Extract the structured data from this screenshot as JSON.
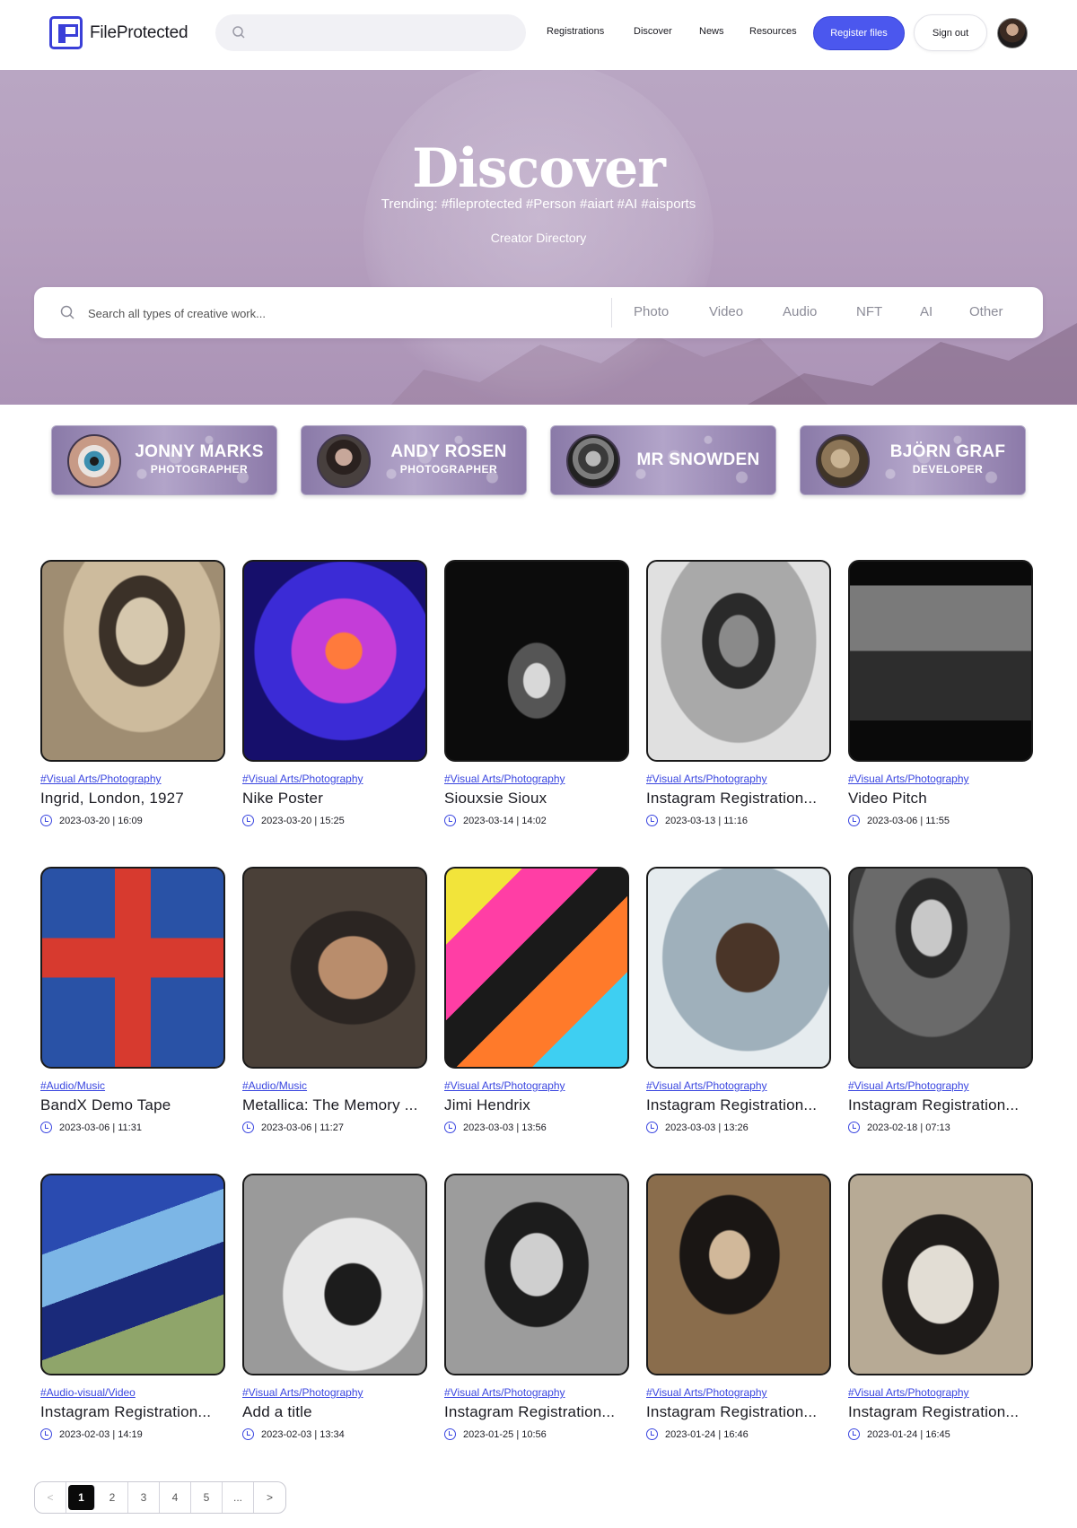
{
  "header": {
    "logo_text": "FileProtected",
    "nav": [
      "Registrations",
      "Discover",
      "News",
      "Resources"
    ],
    "register_label": "Register files",
    "signout_label": "Sign out"
  },
  "hero": {
    "title": "Discover",
    "trending": "Trending: #fileprotected #Person #aiart #AI #aisports",
    "directory_link": "Creator Directory",
    "search_placeholder": "Search all types of creative work...",
    "categories": [
      "Photo",
      "Video",
      "Audio",
      "NFT",
      "AI",
      "Other"
    ]
  },
  "creators": [
    {
      "name": "JONNY MARKS",
      "role": "PHOTOGRAPHER"
    },
    {
      "name": "ANDY ROSEN",
      "role": "PHOTOGRAPHER"
    },
    {
      "name": "MR SNOWDEN",
      "role": ""
    },
    {
      "name": "BJÖRN GRAF",
      "role": "DEVELOPER"
    }
  ],
  "cards": [
    {
      "category": "#Visual Arts/Photography",
      "title": "Ingrid, London, 1927",
      "date": "2023-03-20 | 16:09"
    },
    {
      "category": "#Visual Arts/Photography",
      "title": "Nike Poster",
      "date": "2023-03-20 | 15:25"
    },
    {
      "category": "#Visual Arts/Photography",
      "title": "Siouxsie Sioux",
      "date": "2023-03-14 | 14:02"
    },
    {
      "category": "#Visual Arts/Photography",
      "title": "Instagram Registration...",
      "date": "2023-03-13 | 11:16"
    },
    {
      "category": "#Visual Arts/Photography",
      "title": "Video Pitch",
      "date": "2023-03-06 | 11:55"
    },
    {
      "category": "#Audio/Music",
      "title": "BandX Demo Tape",
      "date": "2023-03-06 | 11:31"
    },
    {
      "category": "#Audio/Music",
      "title": "Metallica: The Memory ...",
      "date": "2023-03-06 | 11:27"
    },
    {
      "category": "#Visual Arts/Photography",
      "title": "Jimi Hendrix",
      "date": "2023-03-03 | 13:56"
    },
    {
      "category": "#Visual Arts/Photography",
      "title": "Instagram Registration...",
      "date": "2023-03-03 | 13:26"
    },
    {
      "category": "#Visual Arts/Photography",
      "title": "Instagram Registration...",
      "date": "2023-02-18 | 07:13"
    },
    {
      "category": "#Audio-visual/Video",
      "title": "Instagram Registration...",
      "date": "2023-02-03 | 14:19"
    },
    {
      "category": "#Visual Arts/Photography",
      "title": "Add a title",
      "date": "2023-02-03 | 13:34"
    },
    {
      "category": "#Visual Arts/Photography",
      "title": "Instagram Registration...",
      "date": "2023-01-25 | 10:56"
    },
    {
      "category": "#Visual Arts/Photography",
      "title": "Instagram Registration...",
      "date": "2023-01-24 | 16:46"
    },
    {
      "category": "#Visual Arts/Photography",
      "title": "Instagram Registration...",
      "date": "2023-01-24 | 16:45"
    }
  ],
  "pagination": {
    "prev": "<",
    "pages": [
      "1",
      "2",
      "3",
      "4",
      "5",
      "..."
    ],
    "next": ">",
    "current": "1"
  },
  "colors": {
    "accent": "#4b57ee",
    "link": "#3a46e0",
    "hero": "#b6a0bf"
  }
}
